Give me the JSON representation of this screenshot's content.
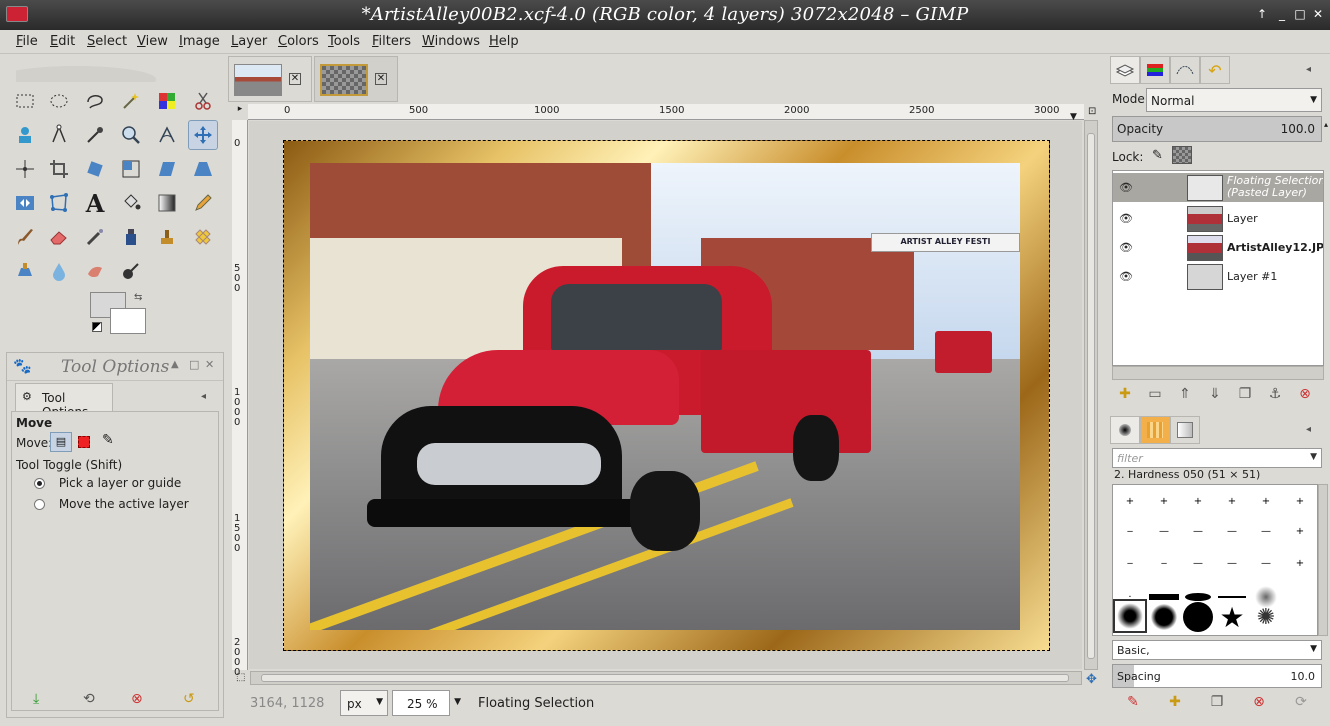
{
  "window": {
    "title": "*ArtistAlley00B2.xcf-4.0 (RGB color, 4 layers) 3072x2048 – GIMP"
  },
  "menu": [
    "File",
    "Edit",
    "Select",
    "View",
    "Image",
    "Layer",
    "Colors",
    "Tools",
    "Filters",
    "Windows",
    "Help"
  ],
  "tool_options": {
    "panel_title": "Tool Options",
    "tab_label": "Tool Options",
    "tool_name": "Move",
    "move_label": "Move:",
    "toggle_label": "Tool Toggle  (Shift)",
    "option_pick": "Pick a layer or guide",
    "option_active": "Move the active layer"
  },
  "ruler": {
    "h_labels": [
      "0",
      "500",
      "1000",
      "1500",
      "2000",
      "2500",
      "3000"
    ],
    "v_labels": [
      "0",
      "5\n0\n0",
      "1\n0\n0\n0",
      "1\n5\n0\n0",
      "2\n0\n0\n0"
    ]
  },
  "photo": {
    "banner_text": "ARTIST ALLEY FESTI"
  },
  "status": {
    "coords": "3164, 1128",
    "unit": "px",
    "zoom": "25 %",
    "message": "Floating Selection"
  },
  "layers": {
    "mode_label": "Mode:",
    "mode_value": "Normal",
    "opacity_label": "Opacity",
    "opacity_value": "100.0",
    "lock_label": "Lock:",
    "items": [
      {
        "name": "Floating Selection\n(Pasted Layer)",
        "selected": true,
        "italic": true
      },
      {
        "name": "Layer",
        "selected": false,
        "italic": false
      },
      {
        "name": "ArtistAlley12.JP",
        "selected": false,
        "italic": false,
        "bold": true
      },
      {
        "name": "Layer #1",
        "selected": false,
        "italic": false
      }
    ]
  },
  "brushes": {
    "filter_placeholder": "filter",
    "selected_brush": "2. Hardness 050 (51 × 51)",
    "brush_set": "Basic,",
    "spacing_label": "Spacing",
    "spacing_value": "10.0"
  },
  "colors": {
    "foreground": "#d8d8d8",
    "background": "#ffffff",
    "selected_layer_bg": "#a9a7a2"
  }
}
